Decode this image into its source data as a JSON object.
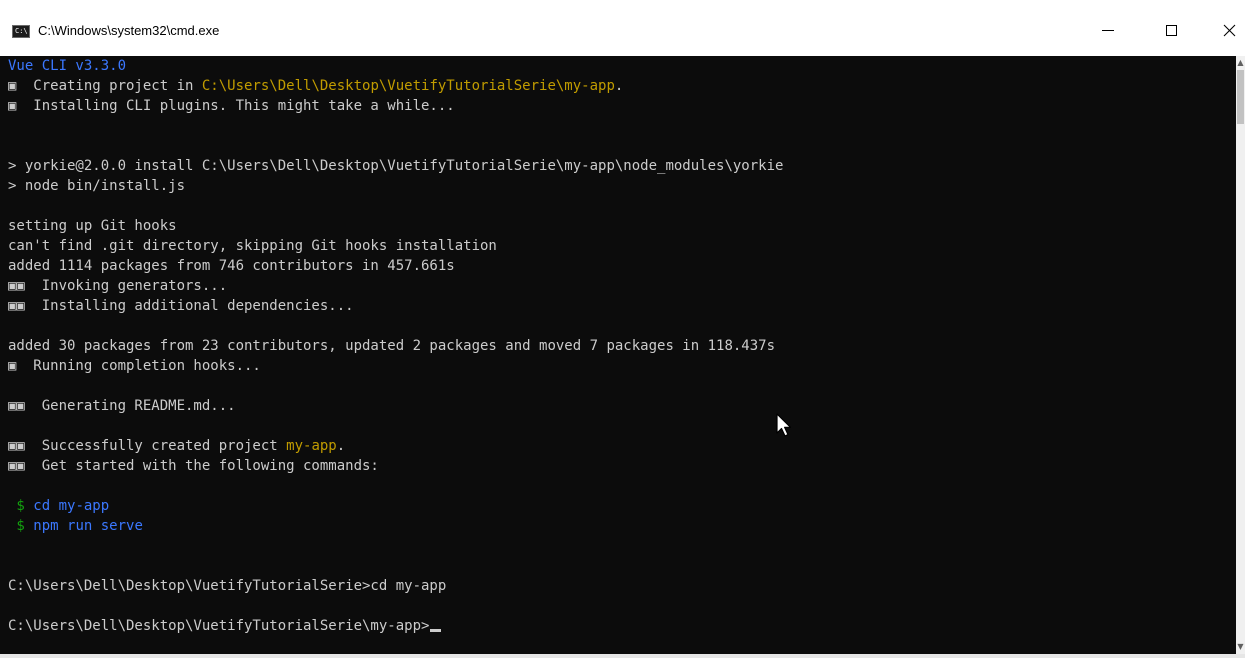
{
  "window": {
    "title": "C:\\Windows\\system32\\cmd.exe",
    "icon": "cmd-icon",
    "controls": {
      "minimize": "–",
      "close": "×"
    }
  },
  "colors": {
    "console_bg": "#0c0c0c",
    "default_text": "#cccccc",
    "yellow": "#c19c00",
    "blue": "#3b78ff",
    "green": "#13a10e"
  },
  "console": {
    "lines": [
      {
        "segments": [
          {
            "t": "Vue CLI v3.3.0",
            "c": "b"
          }
        ]
      },
      {
        "segments": [
          {
            "t": "▣  Creating project in "
          },
          {
            "t": "C:\\Users\\Dell\\Desktop\\VuetifyTutorialSerie\\my-app",
            "c": "y"
          },
          {
            "t": "."
          }
        ]
      },
      {
        "segments": [
          {
            "t": "▣  Installing CLI plugins. This might take a while..."
          }
        ]
      },
      {
        "segments": [
          {
            "t": ""
          }
        ]
      },
      {
        "segments": [
          {
            "t": ""
          }
        ]
      },
      {
        "segments": [
          {
            "t": "> yorkie@2.0.0 install C:\\Users\\Dell\\Desktop\\VuetifyTutorialSerie\\my-app\\node_modules\\yorkie"
          }
        ]
      },
      {
        "segments": [
          {
            "t": "> node bin/install.js"
          }
        ]
      },
      {
        "segments": [
          {
            "t": ""
          }
        ]
      },
      {
        "segments": [
          {
            "t": "setting up Git hooks"
          }
        ]
      },
      {
        "segments": [
          {
            "t": "can't find .git directory, skipping Git hooks installation"
          }
        ]
      },
      {
        "segments": [
          {
            "t": "added 1114 packages from 746 contributors in 457.661s"
          }
        ]
      },
      {
        "segments": [
          {
            "t": "▣▣  Invoking generators..."
          }
        ]
      },
      {
        "segments": [
          {
            "t": "▣▣  Installing additional dependencies..."
          }
        ]
      },
      {
        "segments": [
          {
            "t": ""
          }
        ]
      },
      {
        "segments": [
          {
            "t": "added 30 packages from 23 contributors, updated 2 packages and moved 7 packages in 118.437s"
          }
        ]
      },
      {
        "segments": [
          {
            "t": "▣  Running completion hooks..."
          }
        ]
      },
      {
        "segments": [
          {
            "t": ""
          }
        ]
      },
      {
        "segments": [
          {
            "t": "▣▣  Generating README.md..."
          }
        ]
      },
      {
        "segments": [
          {
            "t": ""
          }
        ]
      },
      {
        "segments": [
          {
            "t": "▣▣  Successfully created project "
          },
          {
            "t": "my-app",
            "c": "y"
          },
          {
            "t": "."
          }
        ]
      },
      {
        "segments": [
          {
            "t": "▣▣  Get started with the following commands:"
          }
        ]
      },
      {
        "segments": [
          {
            "t": ""
          }
        ]
      },
      {
        "segments": [
          {
            "t": " $ ",
            "c": "g"
          },
          {
            "t": "cd my-app",
            "c": "b"
          }
        ]
      },
      {
        "segments": [
          {
            "t": " $ ",
            "c": "g"
          },
          {
            "t": "npm run serve",
            "c": "b"
          }
        ]
      },
      {
        "segments": [
          {
            "t": ""
          }
        ]
      },
      {
        "segments": [
          {
            "t": ""
          }
        ]
      },
      {
        "segments": [
          {
            "t": "C:\\Users\\Dell\\Desktop\\VuetifyTutorialSerie>cd my-app"
          }
        ]
      },
      {
        "segments": [
          {
            "t": ""
          }
        ]
      },
      {
        "segments": [
          {
            "t": "C:\\Users\\Dell\\Desktop\\VuetifyTutorialSerie\\my-app>"
          }
        ],
        "cursor": true
      }
    ]
  }
}
